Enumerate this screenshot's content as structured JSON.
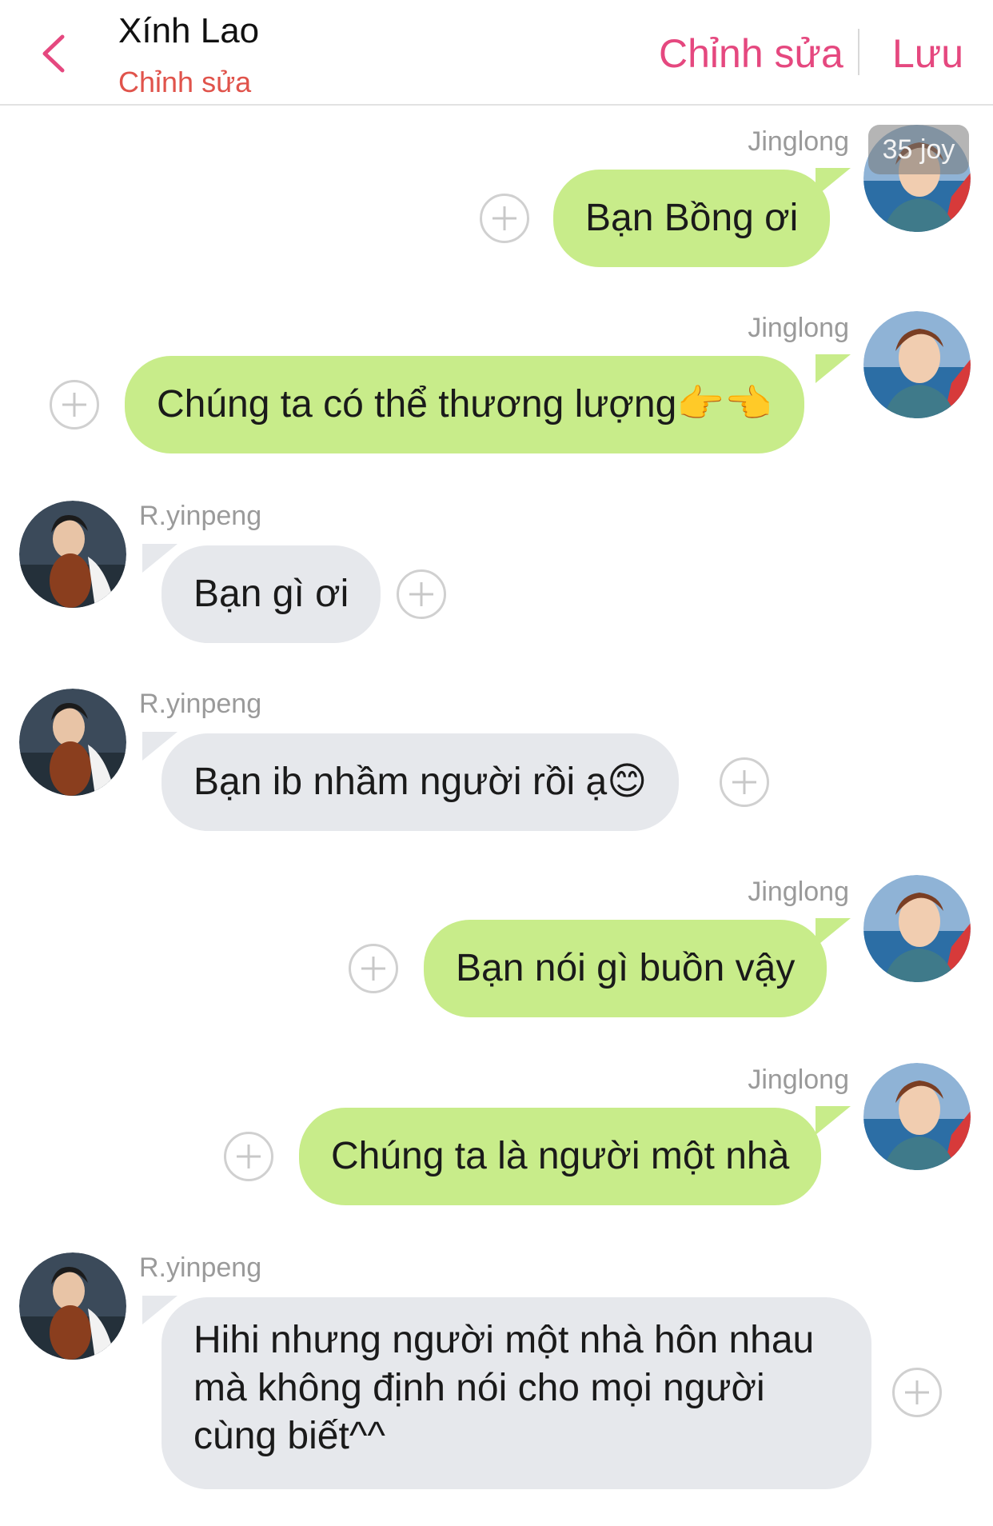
{
  "header": {
    "title": "Xính Lao",
    "subtitle": "Chỉnh sửa",
    "edit_label": "Chỉnh sửa",
    "save_label": "Lưu"
  },
  "badge": "35 joy",
  "messages": [
    {
      "sender": "Jinglong",
      "side": "right",
      "text": "Bạn Bồng ơi"
    },
    {
      "sender": "Jinglong",
      "side": "right",
      "text": "Chúng ta có thể thương lượng👉👈"
    },
    {
      "sender": "R.yinpeng",
      "side": "left",
      "text": "Bạn gì ơi"
    },
    {
      "sender": "R.yinpeng",
      "side": "left",
      "text": "Bạn ib nhầm người rồi ạ😊"
    },
    {
      "sender": "Jinglong",
      "side": "right",
      "text": "Bạn nói gì buồn vậy"
    },
    {
      "sender": "Jinglong",
      "side": "right",
      "text": "Chúng ta là người một nhà"
    },
    {
      "sender": "R.yinpeng",
      "side": "left",
      "lines": [
        "Hihi nhưng người một nhà hôn nhau",
        "mà không định nói cho mọi người",
        "cùng biết^^"
      ]
    }
  ],
  "colors": {
    "accent": "#e5487f",
    "subtitle": "#e0534b",
    "bubble_me": "#c8ec8a",
    "bubble_them": "#e6e8ec"
  }
}
